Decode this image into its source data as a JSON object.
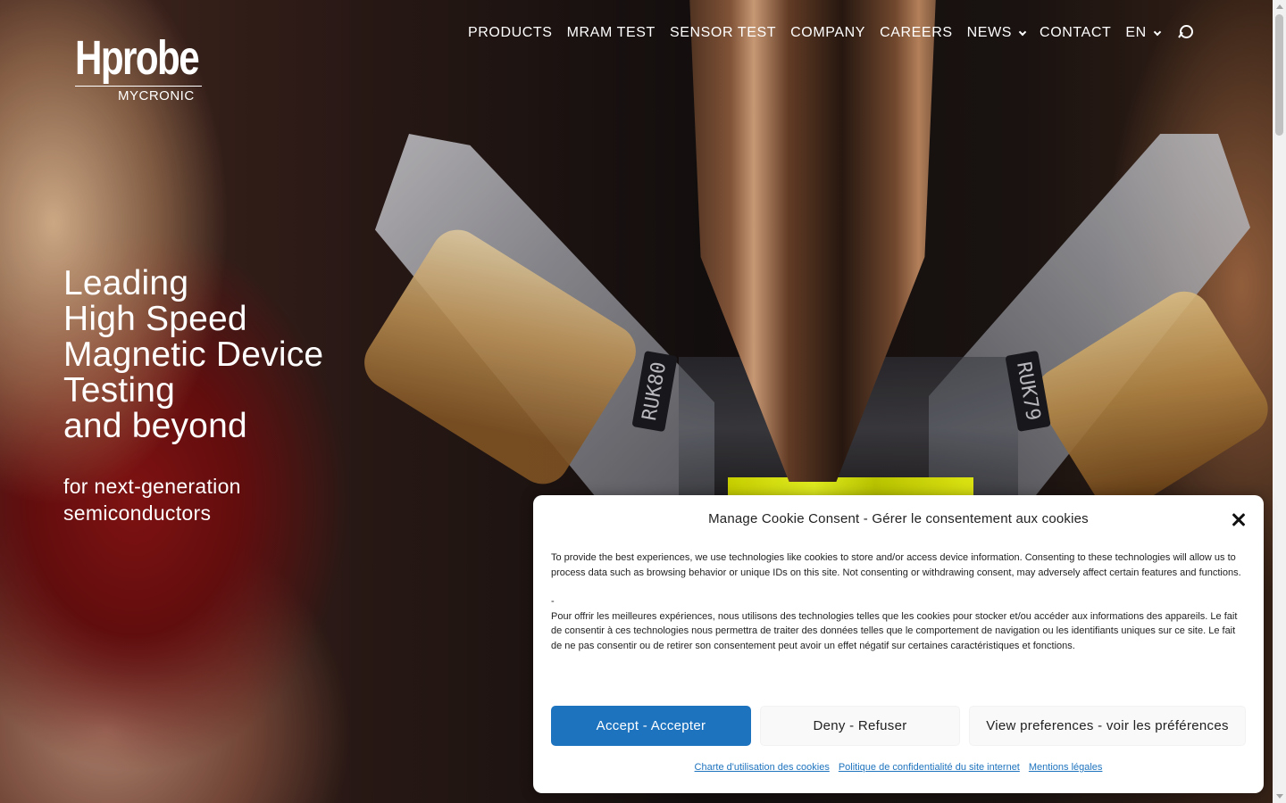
{
  "brand": {
    "logo_main": "Hprobe",
    "logo_sub": "MYCRONIC"
  },
  "nav": {
    "items": [
      {
        "label": "PRODUCTS"
      },
      {
        "label": "MRAM TEST"
      },
      {
        "label": "SENSOR TEST"
      },
      {
        "label": "COMPANY"
      },
      {
        "label": "CAREERS"
      },
      {
        "label": "NEWS"
      },
      {
        "label": "CONTACT"
      },
      {
        "label": "EN"
      }
    ],
    "icons": [
      "chevron-down-icon",
      "search-icon"
    ]
  },
  "hero": {
    "headline_lines": [
      "Leading",
      "High Speed",
      "Magnetic Device",
      "Testing",
      "and beyond"
    ],
    "subline_lines": [
      "for next-generation",
      "semiconductors"
    ],
    "chip_labels": [
      "RUK80",
      "RUK79"
    ]
  },
  "cookie": {
    "title": "Manage Cookie Consent - Gérer le consentement aux cookies",
    "body_en": "To provide the best experiences, we use technologies like cookies to store and/or access device information. Consenting to these technologies will allow us to process data such as browsing behavior or unique IDs on this site. Not consenting or withdrawing consent, may adversely affect certain features and functions.",
    "separator": "-",
    "body_fr": "Pour offrir les meilleures expériences, nous utilisons des technologies telles que les cookies pour stocker et/ou accéder aux informations des appareils. Le fait de consentir à ces technologies nous permettra de traiter des données telles que le comportement de navigation ou les identifiants uniques sur ce site. Le fait de ne pas consentir ou de retirer son consentement peut avoir un effet négatif sur certaines caractéristiques et fonctions.",
    "buttons": {
      "accept": "Accept - Accepter",
      "deny": "Deny - Refuser",
      "preferences": "View preferences - voir les préférences"
    },
    "links": [
      {
        "label": "Charte d'utilisation des cookies"
      },
      {
        "label": "Politique de confidentialité du site internet"
      },
      {
        "label": "Mentions légales"
      }
    ]
  },
  "colors": {
    "accent": "#1e73be",
    "dialog_bg": "#ffffff",
    "nav_text": "#ffffff"
  }
}
